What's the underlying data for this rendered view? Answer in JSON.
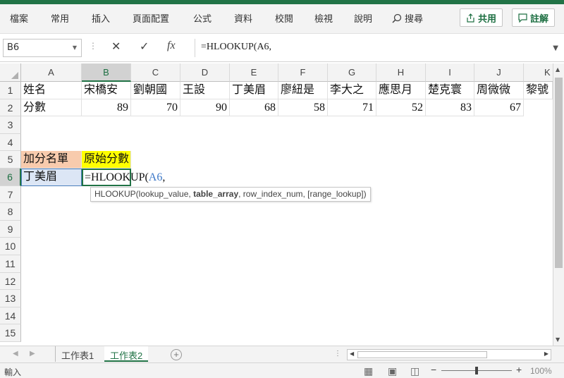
{
  "ribbon": {
    "menu": [
      "檔案",
      "常用",
      "插入",
      "頁面配置",
      "公式",
      "資料",
      "校閱",
      "檢視",
      "說明",
      "搜尋"
    ],
    "share_label": "共用",
    "comment_label": "註解",
    "accent": "#217346"
  },
  "formula_bar": {
    "name_box": "B6",
    "formula": "=HLOOKUP(A6,"
  },
  "columns": [
    "A",
    "B",
    "C",
    "D",
    "E",
    "F",
    "G",
    "H",
    "I",
    "J",
    "K"
  ],
  "rows": [
    "1",
    "2",
    "3",
    "4",
    "5",
    "6",
    "7",
    "8",
    "9",
    "10",
    "11",
    "12",
    "13",
    "14",
    "15"
  ],
  "cells": {
    "A1": "姓名",
    "B1": "宋橋安",
    "C1": "劉朝國",
    "D1": "王設",
    "E1": "丁美眉",
    "F1": "廖紐是",
    "G1": "李大之",
    "H1": "應思月",
    "I1": "楚克寰",
    "J1": "周微微",
    "K1": "黎號",
    "A2": "分數",
    "B2": "89",
    "C2": "70",
    "D2": "90",
    "E2": "68",
    "F2": "58",
    "G2": "71",
    "H2": "52",
    "I2": "83",
    "J2": "67",
    "A5": "加分名單",
    "B5": "原始分數",
    "A6": "丁美眉",
    "B6": "=HLOOKUP(",
    "B6_ref": "A6",
    "B6_tail": ","
  },
  "tooltip": {
    "prefix": "HLOOKUP(lookup_value, ",
    "current": "table_array",
    "suffix": ", row_index_num, [range_lookup])"
  },
  "sheets": [
    "工作表1",
    "工作表2"
  ],
  "active_sheet": "工作表2",
  "status": {
    "mode": "輸入",
    "zoom": "100%"
  },
  "colors": {
    "A5_fill": "#f8cbad",
    "B5_fill": "#ffff00",
    "A6_fill": "#dce6f5",
    "ref_color": "#3c78c8"
  }
}
